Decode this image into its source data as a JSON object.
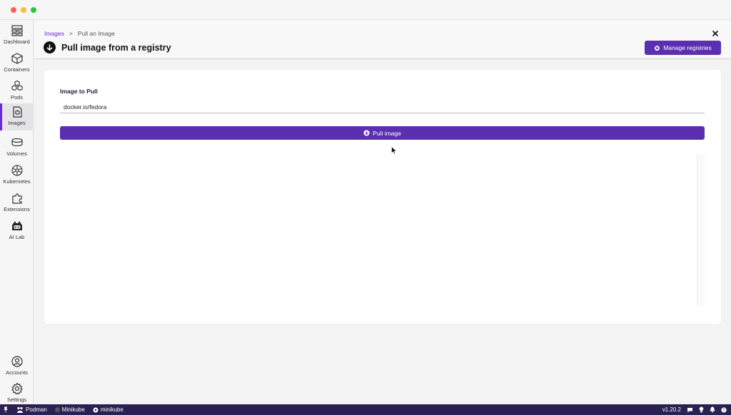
{
  "sidebar": {
    "items": [
      {
        "label": "Dashboard",
        "icon": "dashboard-icon"
      },
      {
        "label": "Containers",
        "icon": "container-icon"
      },
      {
        "label": "Pods",
        "icon": "pods-icon"
      },
      {
        "label": "Images",
        "icon": "images-icon",
        "active": true
      },
      {
        "label": "Volumes",
        "icon": "volumes-icon"
      },
      {
        "label": "Kubernetes",
        "icon": "kubernetes-icon"
      },
      {
        "label": "Extensions",
        "icon": "puzzle-icon"
      },
      {
        "label": "AI Lab",
        "icon": "ai-lab-icon"
      }
    ],
    "bottom": [
      {
        "label": "Accounts",
        "icon": "account-icon"
      },
      {
        "label": "Settings",
        "icon": "gear-icon"
      }
    ]
  },
  "header": {
    "breadcrumb": {
      "parent": "Images",
      "separator": ">",
      "current": "Pull an Image"
    },
    "title": "Pull image from a registry",
    "manage_registries_label": "Manage registries"
  },
  "form": {
    "image_label": "Image to Pull",
    "image_value": "docker.io/fedora",
    "pull_button_label": "Pull image"
  },
  "statusbar": {
    "left": [
      {
        "label": "Podman",
        "icon": "podman-icon"
      },
      {
        "label": "Minikube",
        "icon": "minikube-status-icon"
      },
      {
        "label": "minikube",
        "icon": "kubernetes-context-icon"
      }
    ],
    "version": "v1.20.2"
  },
  "colors": {
    "accent": "#5b2fb0",
    "statusbar": "#2a2152",
    "active_indicator": "#6d28d9"
  }
}
